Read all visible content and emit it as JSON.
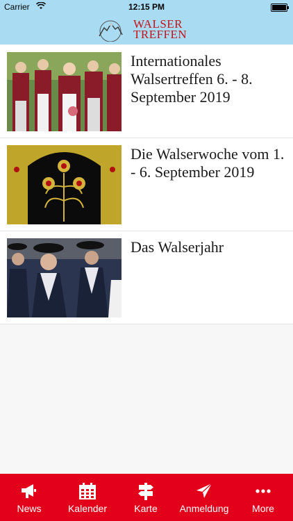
{
  "status_bar": {
    "carrier": "Carrier",
    "time": "12:15 PM"
  },
  "header": {
    "logo_line1": "WALSER",
    "logo_line2": "TREFFEN"
  },
  "news_items": [
    {
      "title": "Internationales Walsertreffen 6. - 8. September 2019"
    },
    {
      "title": "Die Walserwoche vom 1. - 6. September 2019"
    },
    {
      "title": "Das Walserjahr"
    }
  ],
  "tabs": [
    {
      "label": "News",
      "icon": "megaphone-icon"
    },
    {
      "label": "Kalender",
      "icon": "calendar-icon"
    },
    {
      "label": "Karte",
      "icon": "signpost-icon"
    },
    {
      "label": "Anmeldung",
      "icon": "paper-plane-icon"
    },
    {
      "label": "More",
      "icon": "more-dots-icon"
    }
  ],
  "colors": {
    "header": "#a9dcf3",
    "tabbar": "#e2001a",
    "logo_red": "#c4121a"
  }
}
